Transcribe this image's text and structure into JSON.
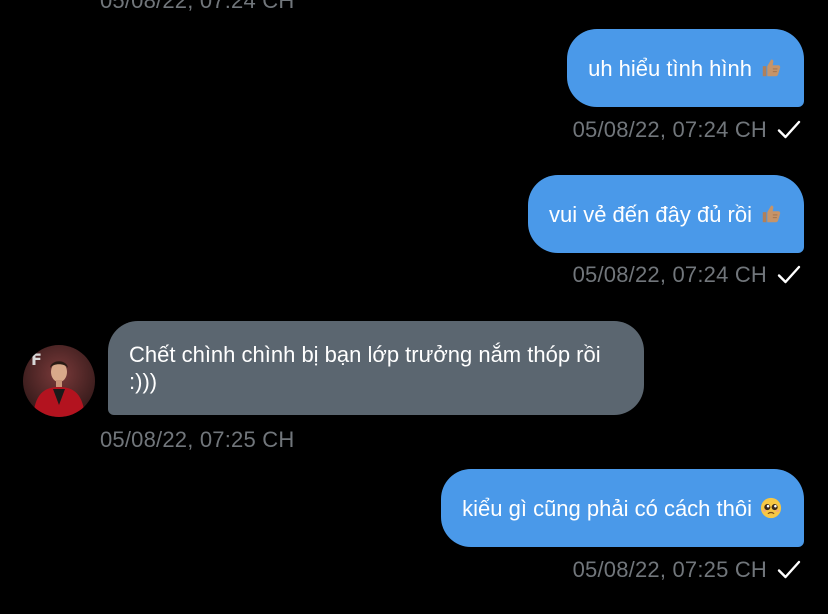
{
  "messages": [
    {
      "text": "uh hiểu tình hình",
      "emoji": "thumbs-up",
      "time": "05/08/22, 07:24 CH",
      "sender": "self",
      "seen": true
    },
    {
      "text": "vui vẻ đến đây đủ rồi",
      "emoji": "thumbs-up",
      "time": "05/08/22, 07:24 CH",
      "sender": "self",
      "seen": true
    },
    {
      "text": "Chết chình chình bị bạn lớp trưởng nắm thóp rồi :)))",
      "time": "05/08/22, 07:25 CH",
      "sender": "other"
    },
    {
      "text": "kiểu gì cũng phải có cách thôi",
      "emoji": "pleading-face",
      "time": "05/08/22, 07:25 CH",
      "sender": "self",
      "seen": true
    }
  ],
  "partial_top_timestamp": "05/08/22, 07:24 CH",
  "colors": {
    "outgoing_bubble": "#4a99e9",
    "incoming_bubble": "#5b6670",
    "timestamp": "#71767b",
    "background": "#000000"
  }
}
